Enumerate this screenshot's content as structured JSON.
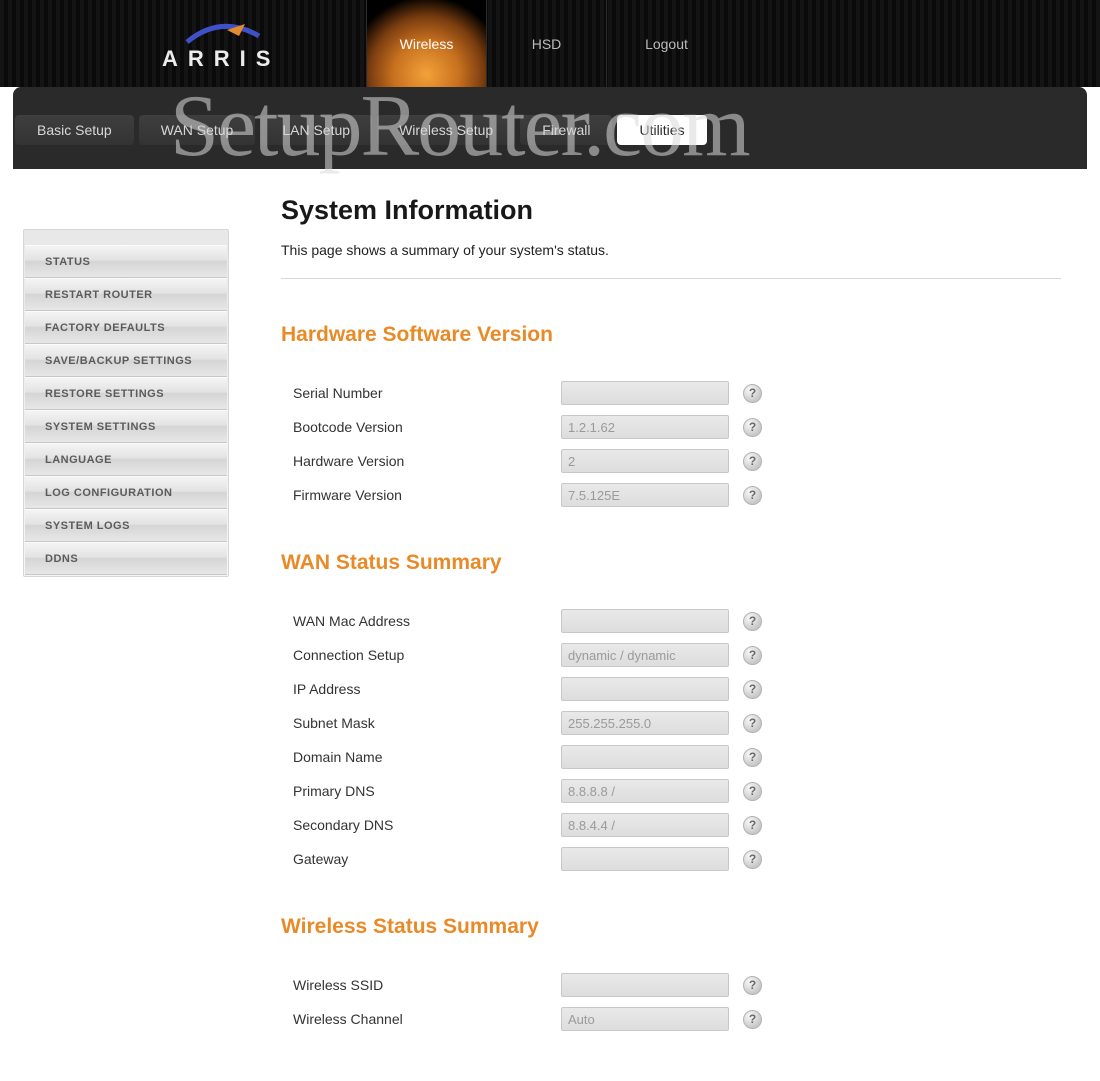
{
  "logo": {
    "word": "ARRIS"
  },
  "primaryNav": {
    "items": [
      {
        "label": "Wireless",
        "active": true
      },
      {
        "label": "HSD",
        "active": false
      },
      {
        "label": "Logout",
        "active": false
      }
    ]
  },
  "watermark": "SetupRouter.com",
  "subTabs": [
    {
      "label": "Basic Setup",
      "active": false
    },
    {
      "label": "WAN Setup",
      "active": false
    },
    {
      "label": "LAN Setup",
      "active": false
    },
    {
      "label": "Wireless Setup",
      "active": false
    },
    {
      "label": "Firewall",
      "active": false
    },
    {
      "label": "Utilities",
      "active": true
    }
  ],
  "sideMenu": [
    "STATUS",
    "RESTART ROUTER",
    "FACTORY DEFAULTS",
    "SAVE/BACKUP SETTINGS",
    "RESTORE SETTINGS",
    "SYSTEM SETTINGS",
    "LANGUAGE",
    "LOG CONFIGURATION",
    "SYSTEM LOGS",
    "DDNS"
  ],
  "page": {
    "title": "System Information",
    "desc": "This page shows a summary of your system's status."
  },
  "sections": {
    "hw": {
      "title": "Hardware Software Version",
      "rows": [
        {
          "label": "Serial Number",
          "value": ""
        },
        {
          "label": "Bootcode Version",
          "value": "1.2.1.62"
        },
        {
          "label": "Hardware Version",
          "value": "2"
        },
        {
          "label": "Firmware Version",
          "value": "7.5.125E"
        }
      ]
    },
    "wan": {
      "title": "WAN Status Summary",
      "rows": [
        {
          "label": "WAN Mac Address",
          "value": ""
        },
        {
          "label": "Connection Setup",
          "value": "dynamic / dynamic"
        },
        {
          "label": "IP Address",
          "value": ""
        },
        {
          "label": "Subnet Mask",
          "value": "255.255.255.0"
        },
        {
          "label": "Domain Name",
          "value": ""
        },
        {
          "label": "Primary DNS",
          "value": "8.8.8.8 /"
        },
        {
          "label": "Secondary DNS",
          "value": "8.8.4.4 /"
        },
        {
          "label": "Gateway",
          "value": ""
        }
      ]
    },
    "wifi": {
      "title": "Wireless Status Summary",
      "rows": [
        {
          "label": "Wireless SSID",
          "value": ""
        },
        {
          "label": "Wireless Channel",
          "value": "Auto"
        }
      ]
    }
  },
  "helpGlyph": "?"
}
